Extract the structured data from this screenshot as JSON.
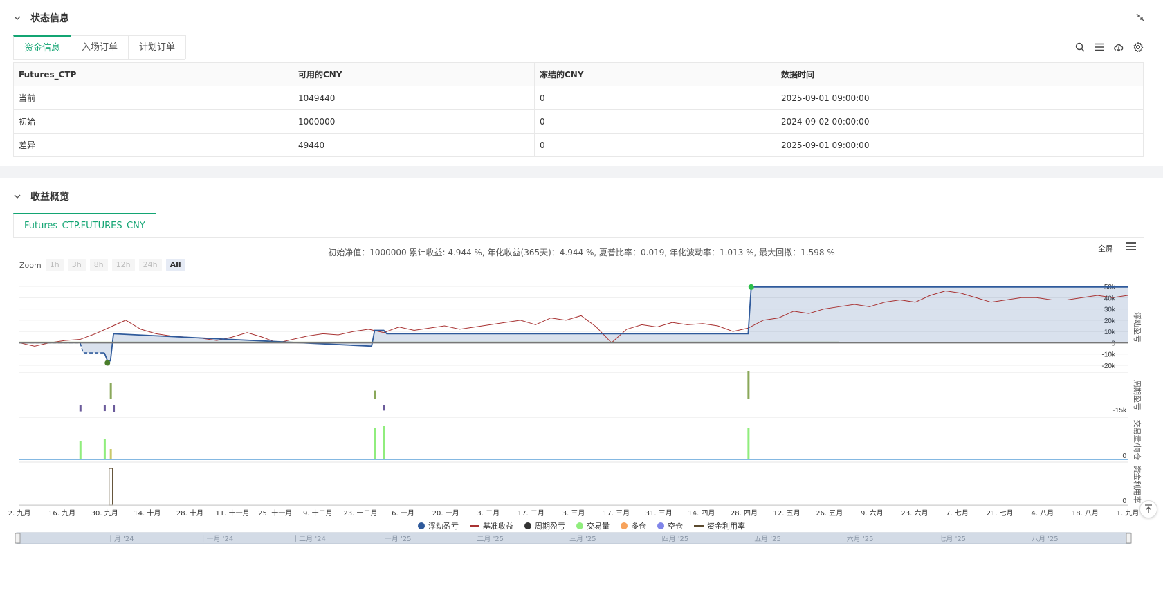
{
  "status_panel": {
    "title": "状态信息",
    "tabs": [
      "资金信息",
      "入场订单",
      "计划订单"
    ],
    "table": {
      "headers": [
        "Futures_CTP",
        "可用的CNY",
        "冻结的CNY",
        "数据时间"
      ],
      "rows": [
        {
          "label": "当前",
          "available": "1049440",
          "frozen": "0",
          "time": "2025-09-01 09:00:00"
        },
        {
          "label": "初始",
          "available": "1000000",
          "frozen": "0",
          "time": "2024-09-02 00:00:00"
        },
        {
          "label": "差异",
          "available": "49440",
          "frozen": "0",
          "time": "2025-09-01 09:00:00"
        }
      ]
    },
    "toolbar_icons": [
      "search-icon",
      "list-icon",
      "cloud-download-icon",
      "gear-icon"
    ]
  },
  "profit_panel": {
    "title": "收益概览",
    "tab": "Futures_CTP.FUTURES_CNY",
    "summary": "初始净值：1000000 累计收益: 4.944 %, 年化收益(365天)：4.944 %, 夏普比率：0.019, 年化波动率：1.013 %, 最大回撤：1.598 %",
    "fullscreen_label": "全屏",
    "zoom": {
      "label": "Zoom",
      "buttons": [
        "1h",
        "3h",
        "8h",
        "12h",
        "24h",
        "All"
      ],
      "active": "All"
    }
  },
  "chart_data": {
    "type": "line",
    "x_tick_labels": [
      "2. 九月",
      "16. 九月",
      "30. 九月",
      "14. 十月",
      "28. 十月",
      "11. 十一月",
      "25. 十一月",
      "9. 十二月",
      "23. 十二月",
      "6. 一月",
      "20. 一月",
      "3. 二月",
      "17. 二月",
      "3. 三月",
      "17. 三月",
      "31. 三月",
      "14. 四月",
      "28. 四月",
      "12. 五月",
      "26. 五月",
      "9. 六月",
      "23. 六月",
      "7. 七月",
      "21. 七月",
      "4. 八月",
      "18. 八月",
      "1. 九月"
    ],
    "navigator_labels": [
      "十月 '24",
      "十一月 '24",
      "十二月 '24",
      "一月 '25",
      "二月 '25",
      "三月 '25",
      "四月 '25",
      "五月 '25",
      "六月 '25",
      "七月 '25",
      "八月 '25"
    ],
    "panes": [
      {
        "name": "浮动盈亏",
        "y_ticks": [
          "50k",
          "40k",
          "30k",
          "20k",
          "10k",
          "0",
          "-10k",
          "-20k"
        ],
        "ylim": [
          -20000,
          50000
        ]
      },
      {
        "name": "周期盈亏",
        "y_ticks": [
          "-15k"
        ]
      },
      {
        "name": "交易量/持仓",
        "y_ticks": [
          "0"
        ]
      },
      {
        "name": "资金利用率",
        "y_ticks": [
          "0"
        ]
      }
    ],
    "series": [
      {
        "name": "浮动盈亏",
        "color": "#2f5a9b",
        "x": [
          0,
          20,
          21,
          28,
          29,
          30,
          31,
          116,
          117,
          120,
          121,
          240,
          241,
          365
        ],
        "values": [
          0,
          0,
          -9000,
          -9000,
          -16000,
          -16000,
          8000,
          -3000,
          11000,
          11000,
          8000,
          8000,
          49440,
          49440
        ]
      },
      {
        "name": "基准收益",
        "color": "#a83232",
        "x": [
          0,
          5,
          10,
          15,
          20,
          25,
          30,
          35,
          40,
          45,
          50,
          55,
          60,
          65,
          70,
          75,
          80,
          85,
          90,
          95,
          100,
          105,
          110,
          115,
          120,
          125,
          130,
          135,
          140,
          145,
          150,
          155,
          160,
          165,
          170,
          175,
          180,
          185,
          190,
          195,
          200,
          205,
          210,
          215,
          220,
          225,
          230,
          235,
          240,
          245,
          250,
          255,
          260,
          265,
          270,
          275,
          280,
          285,
          290,
          295,
          300,
          305,
          310,
          315,
          320,
          325,
          330,
          335,
          340,
          345,
          350,
          355,
          360,
          365
        ],
        "values": [
          0,
          -3000,
          0,
          2000,
          3000,
          8000,
          14000,
          20000,
          12000,
          8000,
          6000,
          5000,
          4000,
          2000,
          5000,
          9000,
          5000,
          0,
          3000,
          6000,
          8000,
          7000,
          10000,
          12000,
          9000,
          14000,
          11000,
          13000,
          15000,
          12000,
          14000,
          16000,
          18000,
          20000,
          16000,
          22000,
          20000,
          24000,
          14000,
          0,
          12000,
          16000,
          14000,
          18000,
          16000,
          17000,
          15000,
          10000,
          13000,
          20000,
          22000,
          28000,
          26000,
          30000,
          32000,
          34000,
          32000,
          36000,
          38000,
          36000,
          42000,
          46000,
          44000,
          40000,
          36000,
          38000,
          40000,
          40000,
          38000,
          38000,
          40000,
          42000,
          40000,
          42000
        ]
      },
      {
        "name": "周期盈亏",
        "color": "#333333"
      },
      {
        "name": "交易量",
        "color": "#90ed7d"
      },
      {
        "name": "多仓",
        "color": "#f7a35c"
      },
      {
        "name": "空仓",
        "color": "#8085e9"
      },
      {
        "name": "资金利用率",
        "color": "#5b4a2e"
      }
    ],
    "period_pnl_bars": [
      {
        "x": 20,
        "value": -1500
      },
      {
        "x": 28,
        "value": -1200
      },
      {
        "x": 30,
        "value": 4000
      },
      {
        "x": 31,
        "value": -2000
      },
      {
        "x": 117,
        "value": 2000
      },
      {
        "x": 120,
        "value": -800
      },
      {
        "x": 240,
        "value": 7000
      }
    ],
    "volume_bars": [
      {
        "x": 20,
        "value": 0.45
      },
      {
        "x": 28,
        "value": 0.5
      },
      {
        "x": 30,
        "value": 0.25
      },
      {
        "x": 117,
        "value": 0.75
      },
      {
        "x": 120,
        "value": 0.8
      },
      {
        "x": 240,
        "value": 0.75
      }
    ]
  },
  "legend": [
    {
      "label": "浮动盈亏",
      "color": "#2f5a9b",
      "kind": "dot"
    },
    {
      "label": "基准收益",
      "color": "#a83232",
      "kind": "line"
    },
    {
      "label": "周期盈亏",
      "color": "#333333",
      "kind": "dot"
    },
    {
      "label": "交易量",
      "color": "#90ed7d",
      "kind": "dot"
    },
    {
      "label": "多仓",
      "color": "#f7a35c",
      "kind": "dot"
    },
    {
      "label": "空仓",
      "color": "#8085e9",
      "kind": "dot"
    },
    {
      "label": "资金利用率",
      "color": "#5b4a2e",
      "kind": "line"
    }
  ]
}
